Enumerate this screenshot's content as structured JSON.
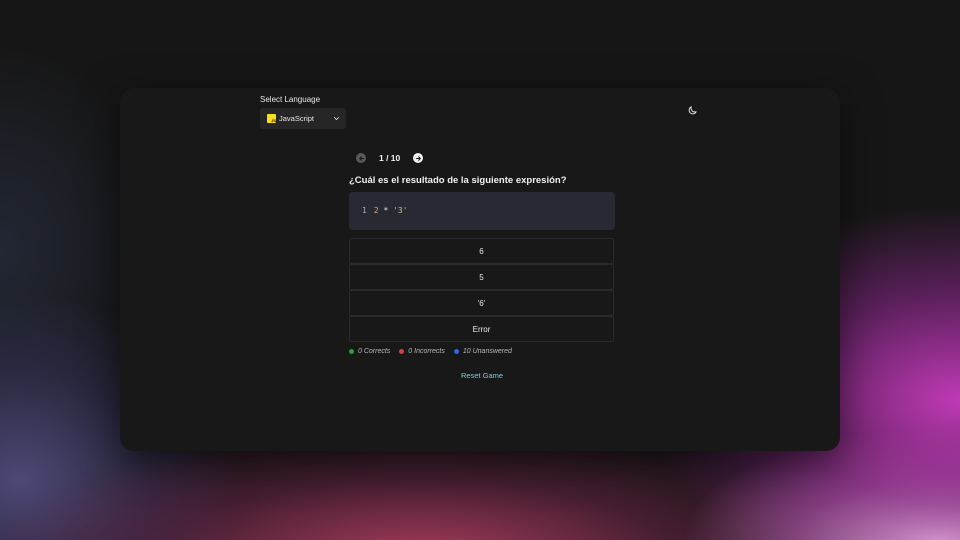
{
  "language": {
    "label": "Select Language",
    "selected": "JavaScript",
    "logo_text": "JS"
  },
  "theme_toggle": {
    "icon": "moon-icon"
  },
  "pager": {
    "indicator": "1 / 10",
    "prev_icon": "arrow-left-icon",
    "next_icon": "arrow-right-icon"
  },
  "question": {
    "text": "¿Cuál es el resultado de la siguiente expresión?",
    "code": {
      "line_number": "1",
      "number": "2",
      "operator": " * ",
      "string": "'3'"
    }
  },
  "options": [
    "6",
    "5",
    "'6'",
    "Error"
  ],
  "stats": {
    "correct": "0 Corrects",
    "incorrect": "0 Incorrects",
    "unanswered": "10 Unanswered"
  },
  "reset_label": "Reset Game",
  "colors": {
    "correct": "#22a33a",
    "incorrect": "#e23b3b",
    "unanswered": "#2f66e0",
    "accent": "#6fd3e6",
    "js_yellow": "#f7df1e"
  }
}
